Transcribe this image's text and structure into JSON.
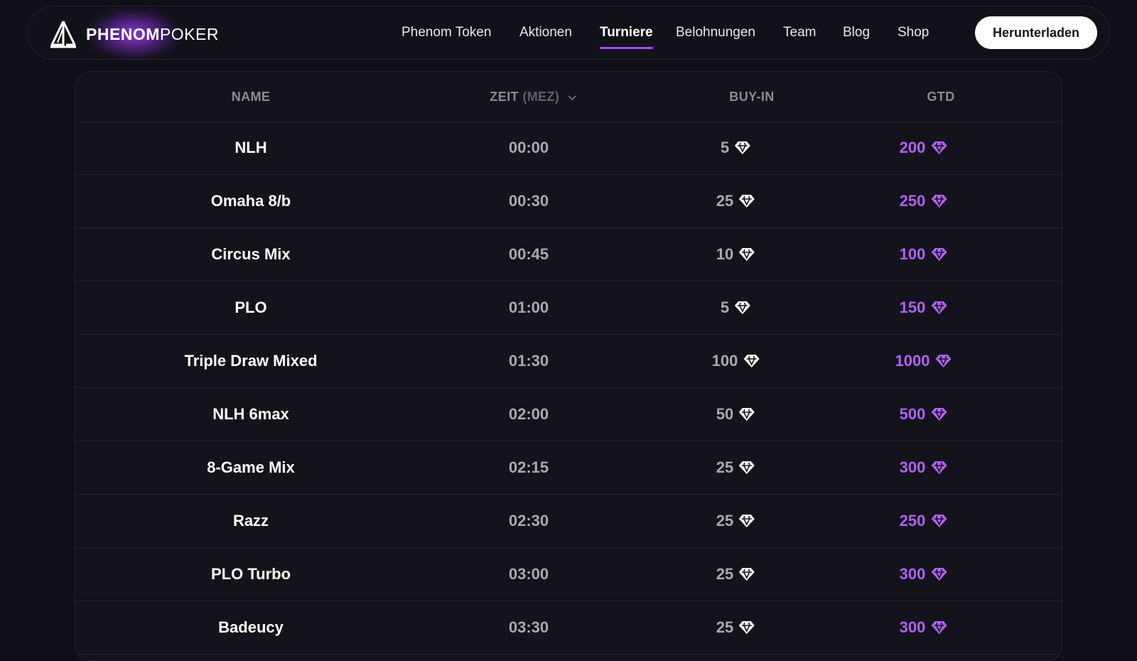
{
  "brand": {
    "name_bold": "PHENOM",
    "name_light": "POKER",
    "logo_icon": "sail-logo-icon"
  },
  "nav": {
    "items": [
      {
        "label": "Phenom Token",
        "active": false
      },
      {
        "label": "Aktionen",
        "active": false
      },
      {
        "label": "Turniere",
        "active": true
      },
      {
        "label": "Belohnungen",
        "active": false
      },
      {
        "label": "Team",
        "active": false
      },
      {
        "label": "Blog",
        "active": false
      },
      {
        "label": "Shop",
        "active": false
      }
    ],
    "download_label": "Herunterladen",
    "accent_color": "#a64dff"
  },
  "table": {
    "headers": {
      "name": "NAME",
      "time": "ZEIT",
      "time_zone": "(MEZ)",
      "buyin": "BUY-IN",
      "gtd": "GTD"
    },
    "sort_icon": "chevron-down-icon",
    "currency_icon": "diamond-icon",
    "gtd_color": "#b260f5",
    "rows": [
      {
        "name": "NLH",
        "time": "00:00",
        "buyin": "5",
        "gtd": "200"
      },
      {
        "name": "Omaha 8/b",
        "time": "00:30",
        "buyin": "25",
        "gtd": "250"
      },
      {
        "name": "Circus Mix",
        "time": "00:45",
        "buyin": "10",
        "gtd": "100"
      },
      {
        "name": "PLO",
        "time": "01:00",
        "buyin": "5",
        "gtd": "150"
      },
      {
        "name": "Triple Draw Mixed",
        "time": "01:30",
        "buyin": "100",
        "gtd": "1000"
      },
      {
        "name": "NLH 6max",
        "time": "02:00",
        "buyin": "50",
        "gtd": "500"
      },
      {
        "name": "8-Game Mix",
        "time": "02:15",
        "buyin": "25",
        "gtd": "300"
      },
      {
        "name": "Razz",
        "time": "02:30",
        "buyin": "25",
        "gtd": "250"
      },
      {
        "name": "PLO Turbo",
        "time": "03:00",
        "buyin": "25",
        "gtd": "300"
      },
      {
        "name": "Badeucy",
        "time": "03:30",
        "buyin": "25",
        "gtd": "300"
      }
    ]
  }
}
